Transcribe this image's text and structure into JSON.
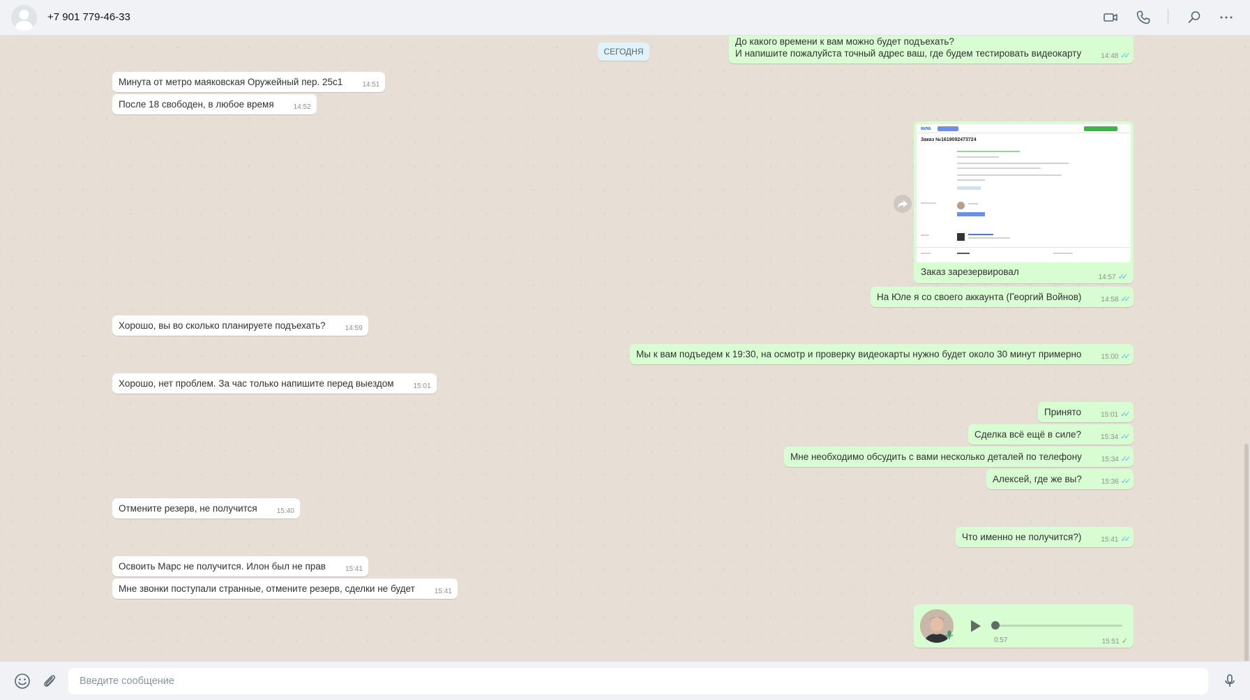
{
  "header": {
    "contact_name": "+7 901 779-46-33"
  },
  "date_separator": "СЕГОДНЯ",
  "messages": [
    {
      "dir": "out",
      "lines": [
        "До какого времени к вам можно будет подъехать?",
        "И напишите  пожалуйста точный адрес ваш, где будем тестировать видеокарту"
      ],
      "time": "14:48"
    },
    {
      "dir": "in",
      "text": "Минута от метро маяковская Оружейный пер. 25с1",
      "time": "14:51"
    },
    {
      "dir": "in",
      "text": "После 18 свободен, в любое время",
      "time": "14:52"
    },
    {
      "dir": "out",
      "text": "Заказ зарезервировал",
      "time": "14:57",
      "image": true
    },
    {
      "dir": "out",
      "text": "На Юле я со своего аккаунта (Георгий Войнов)",
      "time": "14:58"
    },
    {
      "dir": "in",
      "text": "Хорошо, вы во сколько планируете подъехать?",
      "time": "14:59"
    },
    {
      "dir": "out",
      "text": "Мы к вам подъедем к 19:30, на осмотр и проверку видеокарты нужно будет около 30 минут примерно",
      "time": "15:00"
    },
    {
      "dir": "in",
      "text": "Хорошо, нет проблем. За час только напишите перед выездом",
      "time": "15:01"
    },
    {
      "dir": "out",
      "text": "Принято",
      "time": "15:01"
    },
    {
      "dir": "out",
      "text": "Сделка всё ещё в силе?",
      "time": "15:34"
    },
    {
      "dir": "out",
      "text": "Мне необходимо обсудить с вами несколько деталей по телефону",
      "time": "15:34"
    },
    {
      "dir": "out",
      "text": "Алексей, где же вы?",
      "time": "15:36"
    },
    {
      "dir": "in",
      "text": "Отмените резерв, не получится",
      "time": "15:40"
    },
    {
      "dir": "out",
      "text": "Что именно не получится?)",
      "time": "15:41"
    },
    {
      "dir": "in",
      "text": "Освоить Марс не получится. Илон был не прав",
      "time": "15:41"
    },
    {
      "dir": "in",
      "text": "Мне звонки поступали странные, отмените резерв, сделки не будет",
      "time": "15:41"
    }
  ],
  "image_preview": {
    "logo": "юла",
    "order_title": "Заказ №1619092473724"
  },
  "voice": {
    "duration": "0:57",
    "time": "15:51",
    "progress": 0
  },
  "footer": {
    "input_placeholder": "Введите сообщение"
  },
  "ticks": {
    "read": "✓✓",
    "sent": "✓"
  },
  "colors": {
    "incoming": "#ffffff",
    "outgoing": "#d9fdd3",
    "read_tick": "#53bdeb"
  }
}
